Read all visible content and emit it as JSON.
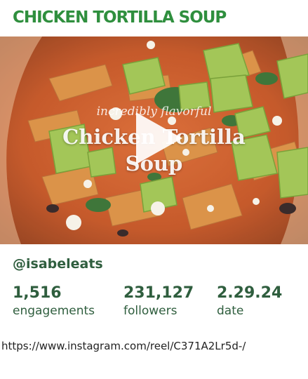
{
  "header": {
    "title": "CHICKEN TORTILLA SOUP"
  },
  "video": {
    "overlay_script": "incredibly flavorful",
    "overlay_title_line1": "Chicken Tortilla",
    "overlay_title_line2": "Soup",
    "play_icon": "play-icon"
  },
  "account": {
    "handle": "@isabeleats"
  },
  "stats": [
    {
      "value": "1,516",
      "label": "engagements"
    },
    {
      "value": "231,127",
      "label": "followers"
    },
    {
      "value": "2.29.24",
      "label": "date"
    }
  ],
  "link": {
    "url": "https://www.instagram.com/reel/C371A2Lr5d-/"
  },
  "colors": {
    "title": "#2f8f3e",
    "text": "#2f5e3e",
    "soup": "#c8541e",
    "avocado": "#8dbb3c"
  }
}
